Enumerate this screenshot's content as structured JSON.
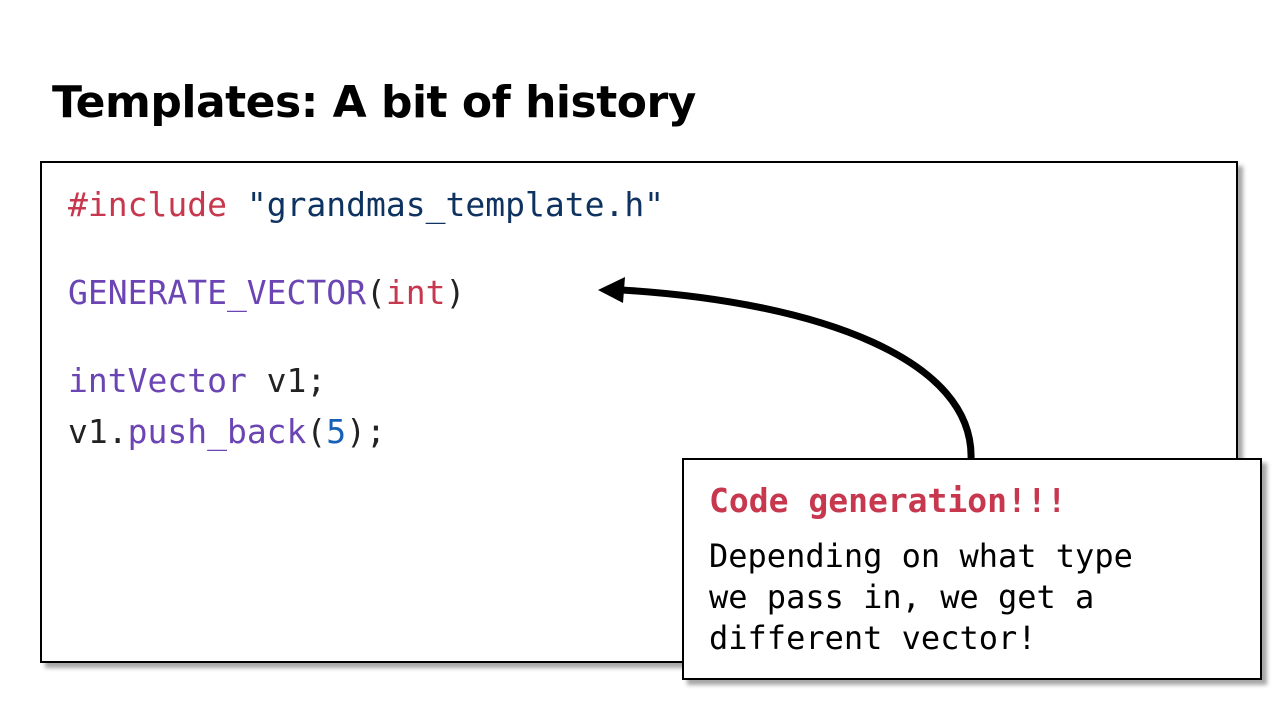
{
  "title": "Templates: A bit of history",
  "code": {
    "include_directive": "#include",
    "include_space": " ",
    "include_file": "\"grandmas_template.h\"",
    "macro_name": "GENERATE_VECTOR",
    "macro_open": "(",
    "macro_arg": "int",
    "macro_close": ")",
    "decl_type": "intVector",
    "decl_rest": " v1;",
    "call_object": "v1.",
    "call_method": "push_back",
    "call_open": "(",
    "call_arg": "5",
    "call_close": ");"
  },
  "callout": {
    "heading": "Code generation!!!",
    "body": "Depending on what type\nwe pass in, we get a\ndifferent vector!"
  },
  "colors": {
    "keyword": "#c7374e",
    "string": "#0f3361",
    "function": "#6b45b3",
    "number": "#1660b8",
    "callout_heading": "#c7374e"
  },
  "icons": {
    "arrow": "curved-arrow-icon"
  }
}
